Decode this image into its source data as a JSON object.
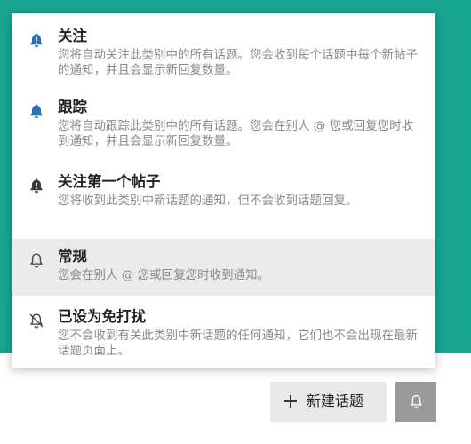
{
  "notification_menu": {
    "options": [
      {
        "title": "关注",
        "description": "您将自动关注此类别中的所有话题。您会收到每个话题中每个新帖子的通知，并且会显示新回复数量。",
        "icon": "bell-icon"
      },
      {
        "title": "跟踪",
        "description": "您将自动跟踪此类别中的所有话题。您会在别人 @ 您或回复您时收到通知，并且会显示新回复数量。",
        "icon": "bell-icon"
      },
      {
        "title": "关注第一个帖子",
        "description": "您将收到此类别中新话题的通知，但不会收到话题回复。",
        "icon": "bell-exclamation-icon"
      },
      {
        "title": "常规",
        "description": "您会在别人 @ 您或回复您时收到通知。",
        "icon": "bell-outline-icon",
        "selected": true
      },
      {
        "title": "已设为免打扰",
        "description": "您不会收到有关此类别中新话题的任何通知，它们也不会出现在最新话题页面上。",
        "icon": "bell-slash-icon"
      }
    ]
  },
  "toolbar": {
    "new_topic_label": "新建话题",
    "new_topic_icon": "plus-icon",
    "notifications_icon": "bell-outline-icon"
  },
  "colors": {
    "banner": "#17a591",
    "selected_row": "#ebebeb",
    "notify_button": "#9a9a9a"
  }
}
